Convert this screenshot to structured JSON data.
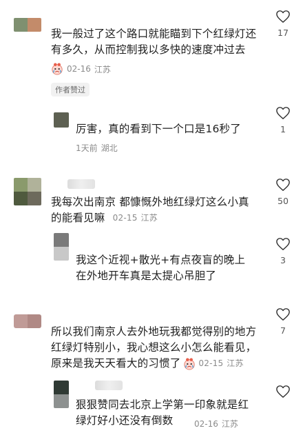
{
  "comments": [
    {
      "text_line1": "我一般过了这个路口就能瞄到下个红绿灯还",
      "text_line2": "有多久，从而控制我以多快的速度冲过去",
      "date": "02-16",
      "location": "江苏",
      "badge": "作者赞过",
      "likes": "17",
      "replies": [
        {
          "text_line1": "厉害，真的看到下一个口是16秒了",
          "date": "1天前",
          "location": "湖北",
          "likes": "1"
        }
      ]
    },
    {
      "text_line1": "我每次出南京 都慷慨外地红绿灯这么小真",
      "text_line2": "的能看见嘛",
      "date": "02-15",
      "location": "江苏",
      "likes": "50",
      "replies": [
        {
          "text_line1": "我这个近视+散光+有点夜盲的晚上",
          "text_line2": "在外地开车真是太提心吊胆了",
          "likes": "3"
        }
      ]
    },
    {
      "text_line1": "所以我们南京人去外地玩我都觉得别的地方",
      "text_line2": "红绿灯特别小，我心想这么小怎么能看见，",
      "text_line3": "原来是我天天看大的习惯了",
      "date": "02-15",
      "location": "江苏",
      "likes": "7",
      "replies": [
        {
          "text_line1": "狠狠赞同去北京上学第一印象就是红",
          "text_line2": "绿灯好小还没有倒数",
          "date": "02-16",
          "location": "江苏"
        }
      ]
    }
  ],
  "icons": {
    "like": "heart-outline-icon",
    "emoji": "crying-face-emoji"
  },
  "colors": {
    "text": "#1f1f1f",
    "meta": "#8a8a8a",
    "badge_bg": "#f1f1f1"
  }
}
